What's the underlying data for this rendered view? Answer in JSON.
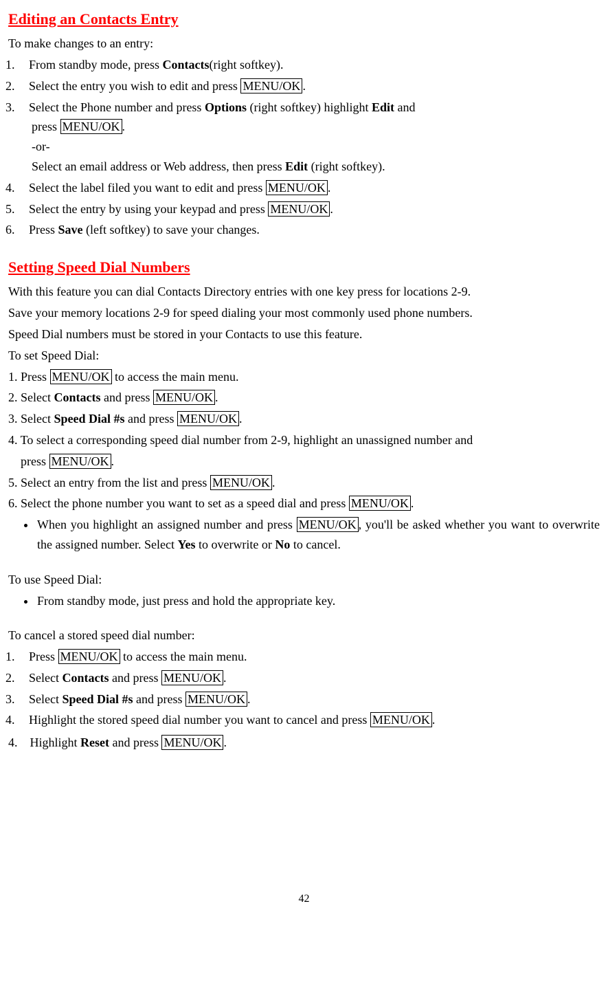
{
  "section1": {
    "title": "Editing an Contacts Entry",
    "intro": "To make changes to an entry:",
    "step1_prefix": "From standby mode, press ",
    "step1_b": "Contacts",
    "step1_suffix": "(right softkey).",
    "step2_prefix": "Select the entry you wish to edit and press ",
    "step2_box": "MENU/OK",
    "step2_suffix": ".",
    "step3_prefix": "Select the Phone number and press ",
    "step3_b1": "Options",
    "step3_mid1": " (right softkey) highlight ",
    "step3_b2": "Edit",
    "step3_mid2": " and",
    "step3_line2_prefix": "press ",
    "step3_line2_box": "MENU/OK",
    "step3_line2_suffix": ".",
    "step3_or": "-or-",
    "step3_alt_prefix": "Select an email address or Web address, then press ",
    "step3_alt_b": "Edit",
    "step3_alt_suffix": " (right softkey).",
    "step4_prefix": "Select the label filed you want to edit and press ",
    "step4_box": "MENU/OK",
    "step4_suffix": ".",
    "step5_prefix": "Select the entry by using your keypad and press ",
    "step5_box": "MENU/OK",
    "step5_suffix": ".",
    "step6_prefix": "Press ",
    "step6_b": "Save",
    "step6_suffix": " (left softkey) to save your changes."
  },
  "section2": {
    "title": "Setting Speed Dial Numbers",
    "para1": "With this feature you can dial Contacts Directory entries with one key press for locations 2-9.",
    "para2": "Save your memory locations 2-9 for speed dialing your most commonly used phone numbers.",
    "para3": "Speed Dial numbers must be stored in your Contacts to use this feature.",
    "toset": "To set Speed Dial:",
    "s1_prefix": "1. Press ",
    "s1_box": "MENU/OK",
    "s1_suffix": " to access the main menu.",
    "s2_prefix": "2. Select ",
    "s2_b": "Contacts",
    "s2_mid": " and press ",
    "s2_box": "MENU/OK",
    "s2_suffix": ".",
    "s3_prefix": "3. Select ",
    "s3_b": "Speed Dial #s",
    "s3_mid": " and press ",
    "s3_box": "MENU/OK",
    "s3_suffix": ".",
    "s4_line1": "4. To select a corresponding speed dial number from 2-9, highlight an unassigned number and",
    "s4_line2_prefix": "press ",
    "s4_line2_box": "MENU/OK",
    "s4_line2_suffix": ".",
    "s5_prefix": "5. Select an entry from the list and press ",
    "s5_box": "MENU/OK",
    "s5_suffix": ".",
    "s6_prefix": "6. Select the phone number you want to set as a speed dial and press ",
    "s6_box": "MENU/OK",
    "s6_suffix": ".",
    "bul1_prefix": "When you highlight an assigned number and press ",
    "bul1_box": "MENU/OK",
    "bul1_mid": ", you'll be asked whether you want to overwrite the assigned number. Select ",
    "bul1_b1": "Yes",
    "bul1_mid2": " to overwrite or ",
    "bul1_b2": "No",
    "bul1_suffix": " to cancel.",
    "touse": "To use Speed Dial:",
    "bul2": "From standby mode, just press and hold the appropriate key.",
    "tocancel": "To cancel a stored speed dial number:",
    "c1_prefix": "Press ",
    "c1_box": "MENU/OK",
    "c1_suffix": " to access the main menu.",
    "c2_prefix": "Select ",
    "c2_b": "Contacts",
    "c2_mid": " and press ",
    "c2_box": "MENU/OK",
    "c2_suffix": ".",
    "c3_prefix": "Select ",
    "c3_b": "Speed Dial #s",
    "c3_mid": " and press ",
    "c3_box": "MENU/OK",
    "c3_suffix": ".",
    "c4_prefix": "Highlight the stored speed dial number you want to cancel and press ",
    "c4_box": "MENU/OK",
    "c4_suffix": ".",
    "c4b_num": "4.",
    "c4b_prefix": "Highlight ",
    "c4b_b": "Reset",
    "c4b_mid": " and press ",
    "c4b_box": "MENU/OK",
    "c4b_suffix": "."
  },
  "page": "42"
}
